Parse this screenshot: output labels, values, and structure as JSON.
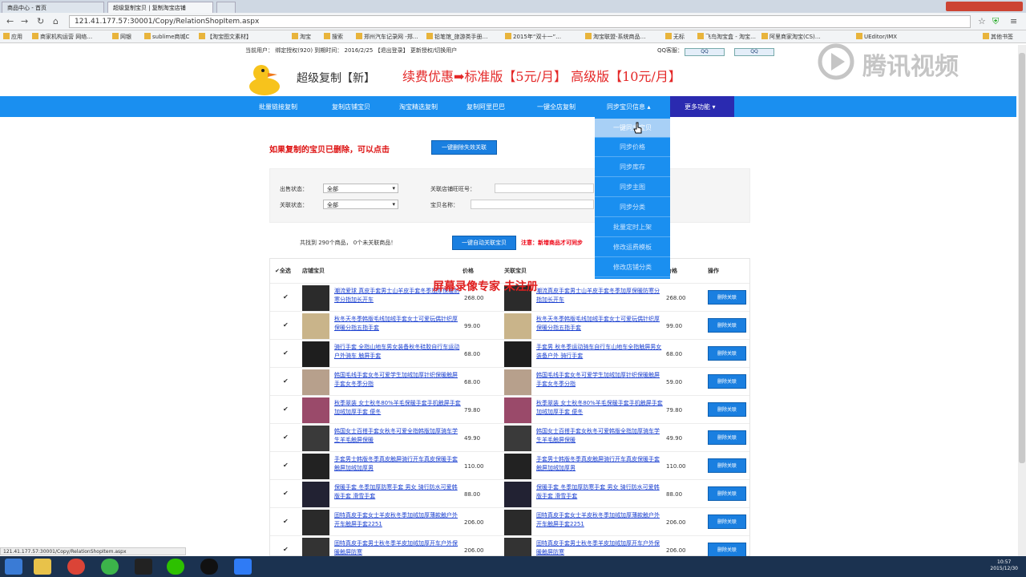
{
  "browser": {
    "tabs": [
      "商品中心 - 首页",
      "超级复制宝贝 | 复制淘宝店铺"
    ],
    "url": "121.41.177.57:30001/Copy/RelationShopItem.aspx",
    "bookmarks": [
      "应用",
      "商家机构运营 网络…",
      "网银",
      "sublime商城C",
      "【淘宝图文素材】",
      "",
      "",
      "淘宝",
      "搜索",
      "郑州汽车记录网 -郑…",
      "铅笔馆_旅游类手册…",
      "2015年“双十一”…",
      "淘宝联盟-系统商品…",
      "无标",
      "飞鸟淘宝盒 - 淘宝…",
      "阿里商家淘宝(CS)…",
      "UEditor/IMX",
      "其他书签"
    ]
  },
  "topbar": {
    "info": "当前用户：  绑定授权(920)  到期时间： 2016/2/25    【退出登录】   更新授权/切换用户",
    "qq_label": "QQ客服："
  },
  "header": {
    "brand": "超级复制【新】",
    "promo": "续费优惠➡标准版【5元/月】 高级版【10元/月】",
    "watermark": "腾讯视频"
  },
  "nav": {
    "items": [
      "批量链接复制",
      "复制店铺宝贝",
      "淘宝精选复制",
      "复制阿里巴巴",
      "一键全店复制",
      "同步宝贝信息 ▴"
    ],
    "more": "更多功能 ▾"
  },
  "dropdown": [
    "一键同步宝贝",
    "同步价格",
    "同步库存",
    "同步主图",
    "同步分类",
    "批量定时上架",
    "修改运费模板",
    "修改店铺分类"
  ],
  "notice": {
    "text": "如果复制的宝贝已删除，可以点击",
    "button": "一键删除失效关联"
  },
  "filters": {
    "sale_label": "出售状态：",
    "sale_value": "全部",
    "rel_label": "关联状态：",
    "rel_value": "全部",
    "shop_label": "关联店铺旺旺号：",
    "name_label": "宝贝名称："
  },
  "summary": {
    "text": "共找到  290个商品，  0个未关联商品！",
    "button": "一键自动关联宝贝",
    "warn": "注意：新增商品才可同步"
  },
  "table": {
    "headers": [
      "全选",
      "店铺宝贝",
      "价格",
      "关联宝贝",
      "价格",
      "操作"
    ],
    "action_label": "删除关联",
    "overlay": "屏幕录像专家  未注册",
    "rows": [
      {
        "left": "潮流爱球 真皮手套男士山羊皮手套冬季加厚保暖防寒分指加长开车",
        "lp": "268.00",
        "right": "潮流真皮手套男士山羊皮手套冬季加厚保暖防寒分指加长开车",
        "rp": "268.00"
      },
      {
        "left": "秋冬天冬季韩版毛线加绒手套女士可爱玩偶针织厚保暖分指五指手套",
        "lp": "99.00",
        "right": "秋冬天冬季韩版毛线加绒手套女士可爱玩偶针织厚保暖分指五指手套",
        "rp": "99.00"
      },
      {
        "left": "骑行手套 全指山地车男女装备秋冬硅胶自行车运动户外骑车 触屏手套",
        "lp": "68.00",
        "right": "手套男 秋冬季运动骑车自行车山地车全指触屏男女装备户外 骑行手套",
        "rp": "68.00"
      },
      {
        "left": "韩国毛线手套女冬可爱学生加绒加厚针织保暖触屏手套女冬季分指",
        "lp": "68.00",
        "right": "韩国毛线手套女冬可爱学生加绒加厚针织保暖触屏手套女冬季分指",
        "rp": "59.00"
      },
      {
        "left": "秋季翠装 女士秋冬80%羊毛保暖手套手机触屏手套加绒加厚手套 便冬",
        "lp": "79.80",
        "right": "秋季翠装 女士秋冬80%羊毛保暖手套手机触屏手套加绒加厚手套 便冬",
        "rp": "79.80"
      },
      {
        "left": "韩国女士百搭手套女秋冬可爱全指韩版加厚骑车学生羊毛触屏保暖",
        "lp": "49.90",
        "right": "韩国女士百搭手套女秋冬可爱韩版全指加厚骑车学生羊毛触屏保暖",
        "rp": "49.90"
      },
      {
        "left": "手套男士韩版冬季真皮触屏骑行开车真皮保暖手套触屏加绒加厚男",
        "lp": "110.00",
        "right": "手套男士韩版冬季真皮触屏骑行开车真皮保暖手套触屏加绒加厚男",
        "rp": "110.00"
      },
      {
        "left": "保暖手套 冬季加厚防寒手套 男女 骑行防水可爱韩版手套 滑雪手套",
        "lp": "88.00",
        "right": "保暖手套 冬季加厚防寒手套 男女 骑行防水可爱韩版手套 滑雪手套",
        "rp": "88.00"
      },
      {
        "left": "固特真皮手套女士羊皮秋冬季加绒加厚薄款触户外开车触屏手套2251",
        "lp": "206.00",
        "right": "固特真皮手套女士羊皮秋冬季加绒加厚薄款触户外开车触屏手套2251",
        "rp": "206.00"
      },
      {
        "left": "固特真皮手套男士秋冬季羊皮加绒加厚开车户外保暖触屏防寒",
        "lp": "206.00",
        "right": "固特真皮手套男士秋冬季羊皮加绒加厚开车户外保暖触屏防寒",
        "rp": "206.00"
      }
    ]
  },
  "status_url": "121.41.177.57:30001/Copy/RelationShopItem.aspx",
  "taskbar": {
    "time": "10:57",
    "date": "2015/12/30"
  },
  "colors": {
    "nav_blue": "#1a8ff0",
    "nav_more": "#2a2ab0",
    "promo_red": "#e42727",
    "link_blue": "#1a3fd0"
  }
}
